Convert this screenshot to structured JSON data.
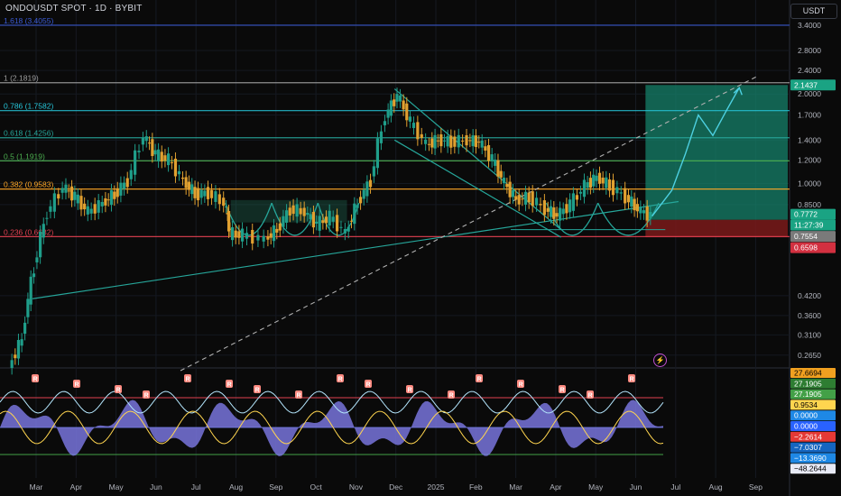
{
  "header": {
    "symbol": "ONDOUSDT SPOT · 1D · BYBIT",
    "currency": "USDT"
  },
  "colors": {
    "background": "#0a0a0a",
    "up_candle": "#1f9e8a",
    "down_candle": "#e0a030",
    "long_zone": "#16806a",
    "trendline": "#26a69a",
    "dashed_trend": "#b0b0b0",
    "stop_zone": "#7a1a1a"
  },
  "x_axis": {
    "labels": [
      "Mar",
      "Apr",
      "May",
      "Jun",
      "Jul",
      "Aug",
      "Sep",
      "Oct",
      "Nov",
      "Dec",
      "2025",
      "Feb",
      "Mar",
      "Apr",
      "May",
      "Jun",
      "Jul",
      "Aug",
      "Sep"
    ]
  },
  "fib_levels": [
    {
      "label": "1.618 (3.4055)",
      "price": 3.4055,
      "color": "#3b5bd6"
    },
    {
      "label": "1 (2.1819)",
      "price": 2.1819,
      "color": "#9e9e9e"
    },
    {
      "label": "0.786 (1.7582)",
      "price": 1.7582,
      "color": "#26c6da"
    },
    {
      "label": "0.618 (1.4256)",
      "price": 1.4256,
      "color": "#26a69a"
    },
    {
      "label": "0.5 (1.1919)",
      "price": 1.1919,
      "color": "#4caf50"
    },
    {
      "label": "0.382 (0.9583)",
      "price": 0.9583,
      "color": "#ffa726"
    },
    {
      "label": "0.236 (0.6632)",
      "price": 0.6632,
      "color": "#e04050"
    }
  ],
  "price_ticks": [
    "3.4000",
    "2.8000",
    "2.4000",
    "2.0000",
    "1.7000",
    "1.4000",
    "1.2000",
    "1.0000",
    "0.8500",
    "0.4200",
    "0.3600",
    "0.3100",
    "0.2650"
  ],
  "price_badges": [
    {
      "text": "2.1437",
      "bg": "#1aa383",
      "fg": "#ffffff"
    },
    {
      "text": "0.7772",
      "bg": "#1aa383",
      "fg": "#ffffff"
    },
    {
      "text": "11:27:39",
      "bg": "#1aa383",
      "fg": "#ffffff"
    },
    {
      "text": "0.7554",
      "bg": "#7a7a7a",
      "fg": "#ffffff"
    },
    {
      "text": "0.6598",
      "bg": "#d23040",
      "fg": "#ffffff"
    }
  ],
  "oscillator": {
    "badges": [
      {
        "text": "27.6694",
        "bg": "#f0a020",
        "fg": "#000000"
      },
      {
        "text": "27.1905",
        "bg": "#2e7d32",
        "fg": "#ffffff"
      },
      {
        "text": "27.1905",
        "bg": "#43a047",
        "fg": "#ffffff"
      },
      {
        "text": "0.9534",
        "bg": "#ffd54f",
        "fg": "#000000"
      },
      {
        "text": "0.0000",
        "bg": "#1e88e5",
        "fg": "#ffffff"
      },
      {
        "text": "0.0000",
        "bg": "#2962ff",
        "fg": "#ffffff"
      },
      {
        "text": "−2.2614",
        "bg": "#e53935",
        "fg": "#ffffff"
      },
      {
        "text": "−7.0307",
        "bg": "#1565c0",
        "fg": "#ffffff"
      },
      {
        "text": "−13.3690",
        "bg": "#1e88e5",
        "fg": "#ffffff"
      },
      {
        "text": "−48.2644",
        "bg": "#e8eaf6",
        "fg": "#000000"
      }
    ],
    "signal_labels": [
      "R",
      "R",
      "R",
      "R",
      "R",
      "R",
      "R",
      "R",
      "R",
      "R",
      "R",
      "R",
      "R",
      "R",
      "R",
      "R",
      "R"
    ]
  },
  "chart_data": {
    "type": "line",
    "symbol": "ONDOUSDT",
    "timeframe": "1D",
    "exchange": "BYBIT",
    "y_scale": "log",
    "ylim": [
      0.24,
      3.6
    ],
    "x": [
      "2024-02-20",
      "2024-03-01",
      "2024-03-10",
      "2024-03-20",
      "2024-04-01",
      "2024-04-10",
      "2024-04-20",
      "2024-05-01",
      "2024-05-10",
      "2024-05-20",
      "2024-06-01",
      "2024-06-10",
      "2024-06-20",
      "2024-07-01",
      "2024-07-10",
      "2024-07-20",
      "2024-08-01",
      "2024-08-05",
      "2024-08-15",
      "2024-09-01",
      "2024-09-10",
      "2024-09-20",
      "2024-10-01",
      "2024-10-10",
      "2024-10-20",
      "2024-11-01",
      "2024-11-10",
      "2024-11-20",
      "2024-12-01",
      "2024-12-10",
      "2024-12-20",
      "2025-01-01",
      "2025-01-10",
      "2025-01-20",
      "2025-02-01",
      "2025-02-10",
      "2025-02-20",
      "2025-03-01",
      "2025-03-10",
      "2025-03-20",
      "2025-04-01",
      "2025-04-10",
      "2025-04-20",
      "2025-05-01",
      "2025-05-10",
      "2025-05-20",
      "2025-06-01",
      "2025-06-10",
      "2025-06-20"
    ],
    "series": [
      {
        "values": [
          0.24,
          0.3,
          0.52,
          0.8,
          0.97,
          0.9,
          0.8,
          0.86,
          0.92,
          1.02,
          1.44,
          1.25,
          1.2,
          1.02,
          0.92,
          0.93,
          0.86,
          0.68,
          0.67,
          0.65,
          0.7,
          0.82,
          0.8,
          0.73,
          0.77,
          0.68,
          0.86,
          1.02,
          1.68,
          1.98,
          1.6,
          1.35,
          1.4,
          1.38,
          1.4,
          1.38,
          1.2,
          1.0,
          0.88,
          0.9,
          0.82,
          0.78,
          0.85,
          0.98,
          1.05,
          0.98,
          0.9,
          0.82,
          0.7772
        ]
      }
    ],
    "projection": [
      {
        "x": "2025-06-20",
        "y": 0.7772
      },
      {
        "x": "2025-07-05",
        "y": 0.95
      },
      {
        "x": "2025-07-15",
        "y": 1.25
      },
      {
        "x": "2025-07-25",
        "y": 1.7
      },
      {
        "x": "2025-08-05",
        "y": 1.45
      },
      {
        "x": "2025-08-15",
        "y": 1.75
      },
      {
        "x": "2025-08-25",
        "y": 2.1
      }
    ],
    "last_price": 0.7772,
    "countdown": "11:27:39"
  }
}
